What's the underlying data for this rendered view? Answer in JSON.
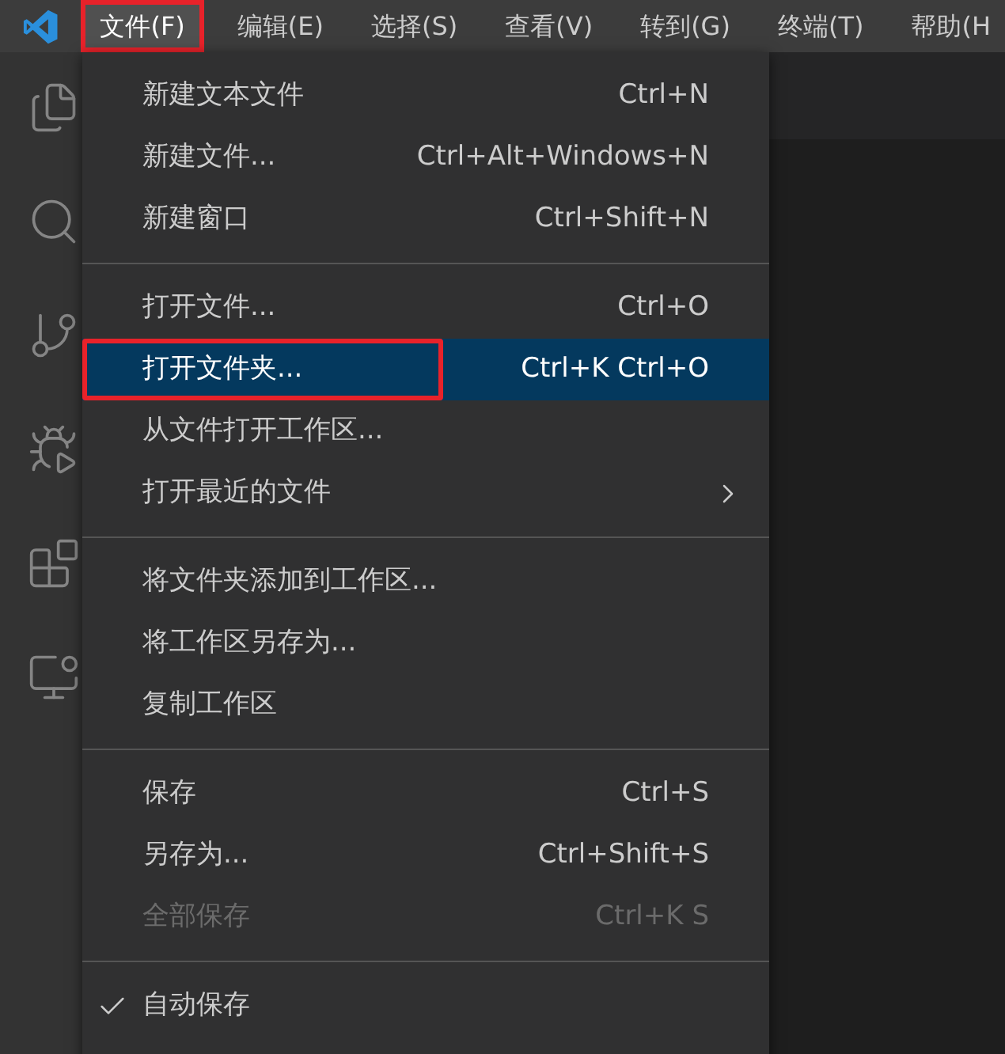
{
  "menubar": [
    {
      "label": "文件(F)",
      "selected": true,
      "annotated": true
    },
    {
      "label": "编辑(E)",
      "selected": false,
      "annotated": false
    },
    {
      "label": "选择(S)",
      "selected": false,
      "annotated": false
    },
    {
      "label": "查看(V)",
      "selected": false,
      "annotated": false
    },
    {
      "label": "转到(G)",
      "selected": false,
      "annotated": false
    },
    {
      "label": "终端(T)",
      "selected": false,
      "annotated": false
    },
    {
      "label": "帮助(H",
      "selected": false,
      "annotated": false
    }
  ],
  "activity_bar": [
    {
      "kind": "files"
    },
    {
      "kind": "search"
    },
    {
      "kind": "git"
    },
    {
      "kind": "debug"
    },
    {
      "kind": "extensions"
    },
    {
      "kind": "remote"
    }
  ],
  "file_menu": [
    {
      "kind": "item",
      "label": "新建文本文件",
      "shortcut": "Ctrl+N",
      "selected": false,
      "disabled": false,
      "checked": false,
      "submenu": false,
      "annotated": false
    },
    {
      "kind": "item",
      "label": "新建文件...",
      "shortcut": "Ctrl+Alt+Windows+N",
      "selected": false,
      "disabled": false,
      "checked": false,
      "submenu": false,
      "annotated": false
    },
    {
      "kind": "item",
      "label": "新建窗口",
      "shortcut": "Ctrl+Shift+N",
      "selected": false,
      "disabled": false,
      "checked": false,
      "submenu": false,
      "annotated": false
    },
    {
      "kind": "separator"
    },
    {
      "kind": "item",
      "label": "打开文件...",
      "shortcut": "Ctrl+O",
      "selected": false,
      "disabled": false,
      "checked": false,
      "submenu": false,
      "annotated": false
    },
    {
      "kind": "item",
      "label": "打开文件夹...",
      "shortcut": "Ctrl+K Ctrl+O",
      "selected": true,
      "disabled": false,
      "checked": false,
      "submenu": false,
      "annotated": true
    },
    {
      "kind": "item",
      "label": "从文件打开工作区...",
      "selected": false,
      "disabled": false,
      "checked": false,
      "submenu": false,
      "annotated": false
    },
    {
      "kind": "item",
      "label": "打开最近的文件",
      "selected": false,
      "disabled": false,
      "checked": false,
      "submenu": true,
      "annotated": false
    },
    {
      "kind": "separator"
    },
    {
      "kind": "item",
      "label": "将文件夹添加到工作区...",
      "selected": false,
      "disabled": false,
      "checked": false,
      "submenu": false,
      "annotated": false
    },
    {
      "kind": "item",
      "label": "将工作区另存为...",
      "selected": false,
      "disabled": false,
      "checked": false,
      "submenu": false,
      "annotated": false
    },
    {
      "kind": "item",
      "label": "复制工作区",
      "selected": false,
      "disabled": false,
      "checked": false,
      "submenu": false,
      "annotated": false
    },
    {
      "kind": "separator"
    },
    {
      "kind": "item",
      "label": "保存",
      "shortcut": "Ctrl+S",
      "selected": false,
      "disabled": false,
      "checked": false,
      "submenu": false,
      "annotated": false
    },
    {
      "kind": "item",
      "label": "另存为...",
      "shortcut": "Ctrl+Shift+S",
      "selected": false,
      "disabled": false,
      "checked": false,
      "submenu": false,
      "annotated": false
    },
    {
      "kind": "item",
      "label": "全部保存",
      "shortcut": "Ctrl+K S",
      "selected": false,
      "disabled": true,
      "checked": false,
      "submenu": false,
      "annotated": false
    },
    {
      "kind": "separator"
    },
    {
      "kind": "item",
      "label": "自动保存",
      "selected": false,
      "disabled": false,
      "checked": true,
      "submenu": false,
      "annotated": false
    }
  ]
}
